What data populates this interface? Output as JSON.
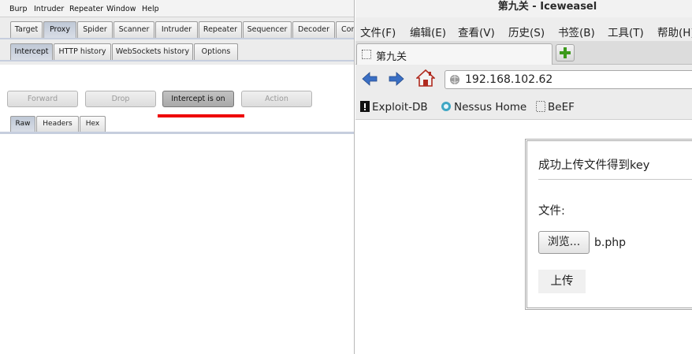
{
  "burp": {
    "menu": [
      "Burp",
      "Intruder",
      "Repeater",
      "Window",
      "Help"
    ],
    "main_tabs": [
      "Target",
      "Proxy",
      "Spider",
      "Scanner",
      "Intruder",
      "Repeater",
      "Sequencer",
      "Decoder",
      "Com"
    ],
    "main_tab_active": "Proxy",
    "proxy_tabs": [
      "Intercept",
      "HTTP history",
      "WebSockets history",
      "Options"
    ],
    "proxy_tab_active": "Intercept",
    "actions": {
      "forward": "Forward",
      "drop": "Drop",
      "intercept": "Intercept is on",
      "action": "Action"
    },
    "view_tabs": [
      "Raw",
      "Headers",
      "Hex"
    ],
    "view_tab_active": "Raw",
    "annotation_color": "#ee0000"
  },
  "browser": {
    "window_title": "第九关 - Iceweasel",
    "menu": [
      "文件(F)",
      "编辑(E)",
      "查看(V)",
      "历史(S)",
      "书签(B)",
      "工具(T)",
      "帮助(H)"
    ],
    "tab_title": "第九关",
    "url": "192.168.102.62",
    "bookmarks": [
      "Exploit-DB",
      "Nessus Home",
      "BeEF"
    ],
    "page": {
      "heading": "成功上传文件得到key",
      "file_label": "文件:",
      "browse_button": "浏览...",
      "selected_file": "b.php",
      "submit_button": "上传"
    }
  }
}
